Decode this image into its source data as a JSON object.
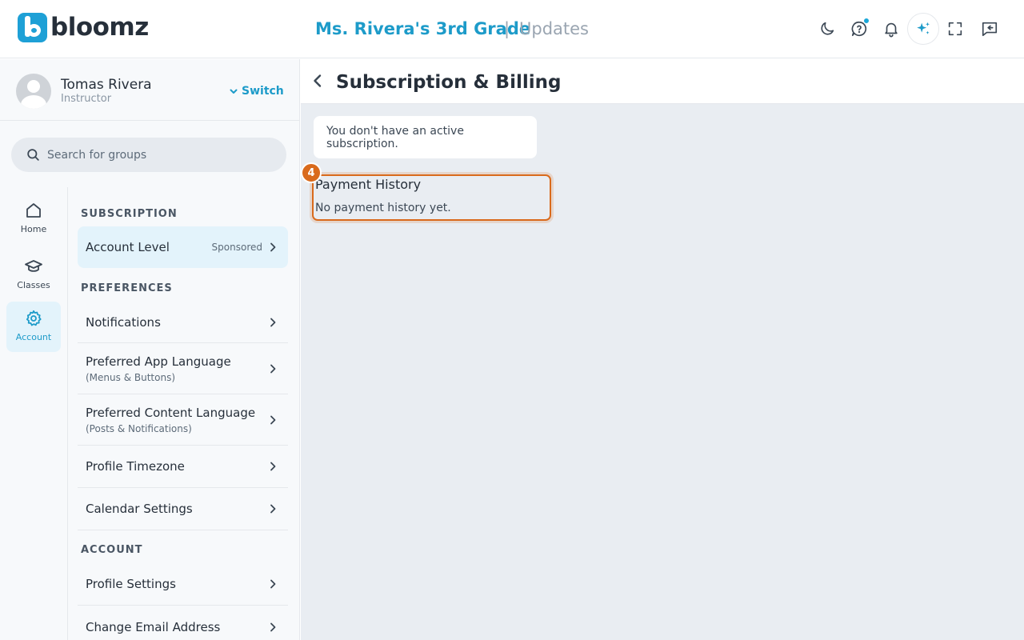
{
  "header": {
    "brand": "bloomz",
    "class_title": "Ms. Rivera's 3rd Grade",
    "separator": "|",
    "view_title": "Updates"
  },
  "profile": {
    "name": "Tomas Rivera",
    "role": "Instructor",
    "switch_label": "Switch"
  },
  "search": {
    "placeholder": "Search for groups"
  },
  "rail": {
    "home": "Home",
    "classes": "Classes",
    "account": "Account"
  },
  "menu": {
    "subscription_head": "SUBSCRIPTION",
    "account_level": "Account Level",
    "account_level_tag": "Sponsored",
    "preferences_head": "PREFERENCES",
    "notifications": "Notifications",
    "app_language": "Preferred App Language",
    "app_language_sub": "(Menus & Buttons)",
    "content_language": "Preferred Content Language",
    "content_language_sub": "(Posts & Notifications)",
    "timezone": "Profile Timezone",
    "calendar": "Calendar Settings",
    "account_head": "ACCOUNT",
    "profile_settings": "Profile Settings",
    "change_email": "Change Email Address"
  },
  "main": {
    "page_title": "Subscription & Billing",
    "notice": "You don't have an active subscription.",
    "step_number": "4",
    "payment_history_title": "Payment History",
    "payment_history_empty": "No payment history yet."
  },
  "colors": {
    "accent": "#1d9bc9",
    "highlight": "#d96a1c"
  }
}
